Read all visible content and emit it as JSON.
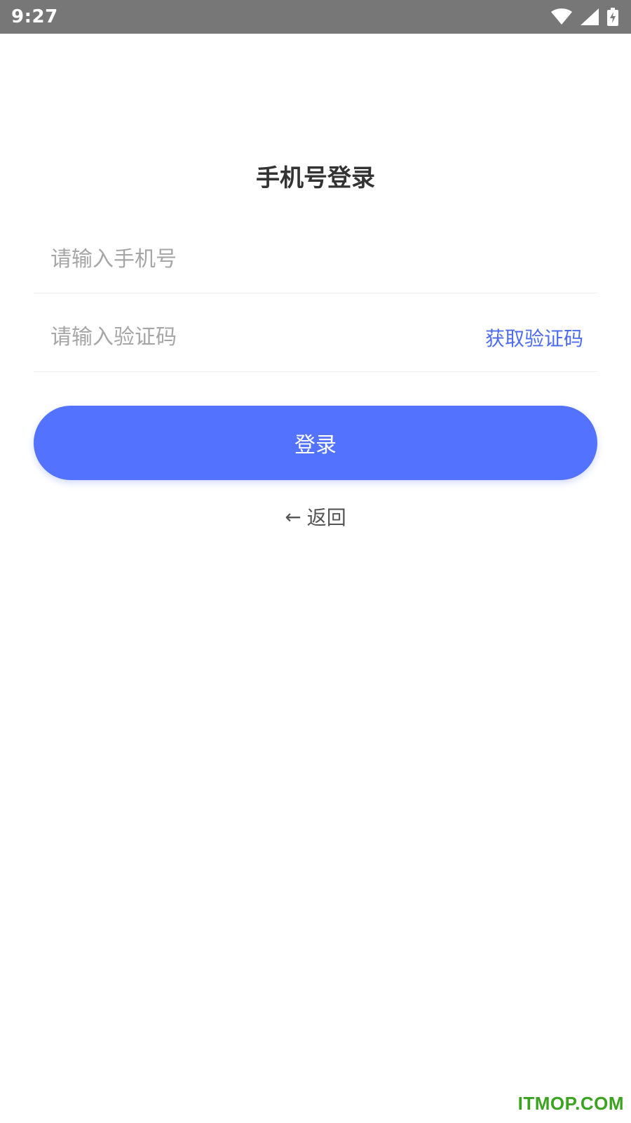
{
  "status_bar": {
    "time": "9:27",
    "icons": [
      "wifi-icon",
      "cell-signal-icon",
      "battery-charging-icon"
    ]
  },
  "page": {
    "title": "手机号登录"
  },
  "form": {
    "phone_placeholder": "请输入手机号",
    "phone_value": "",
    "code_placeholder": "请输入验证码",
    "code_value": "",
    "get_code_label": "获取验证码",
    "login_label": "登录",
    "back_arrow": "←",
    "back_label": "返回"
  },
  "watermark": {
    "text": "ITMOP.COM"
  },
  "colors": {
    "accent": "#5373ff",
    "link": "#4d6cf0",
    "status_bar": "#777777",
    "watermark": "#3aa320"
  }
}
